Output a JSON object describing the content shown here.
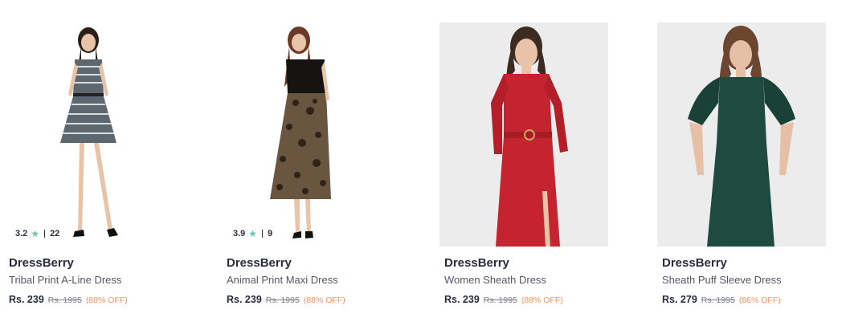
{
  "colors": {
    "discount": "#ff905a",
    "star": "#72bfbc",
    "brand": "#282c3f",
    "muted": "#7e818c"
  },
  "products": [
    {
      "brand": "DressBerry",
      "name": "Tribal Print A-Line Dress",
      "price": "Rs. 239",
      "mrp": "Rs. 1995",
      "discount": "(88% OFF)",
      "rating": "3.2",
      "rating_count": "22",
      "rating_icon": "star-icon"
    },
    {
      "brand": "DressBerry",
      "name": "Animal Print Maxi Dress",
      "price": "Rs. 239",
      "mrp": "Rs. 1995",
      "discount": "(88% OFF)",
      "rating": "3.9",
      "rating_count": "9",
      "rating_icon": "star-icon"
    },
    {
      "brand": "DressBerry",
      "name": "Women Sheath Dress",
      "price": "Rs. 239",
      "mrp": "Rs. 1995",
      "discount": "(88% OFF)"
    },
    {
      "brand": "DressBerry",
      "name": "Sheath Puff Sleeve Dress",
      "price": "Rs. 279",
      "mrp": "Rs. 1995",
      "discount": "(86% OFF)"
    }
  ]
}
